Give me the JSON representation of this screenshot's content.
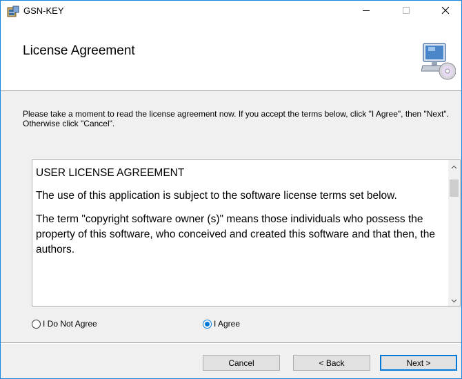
{
  "window": {
    "title": "GSN-KEY",
    "minimize_icon": "minimize-icon",
    "maximize_icon": "maximize-icon",
    "close_icon": "close-icon"
  },
  "header": {
    "title": "License Agreement",
    "icon": "computer-cd-icon"
  },
  "instructions": "Please take a moment to read the license agreement now. If you accept the terms below, click \"I Agree\", then \"Next\". Otherwise click \"Cancel\".",
  "license": {
    "heading": "USER LICENSE AGREEMENT",
    "paragraphs": [
      "The use of this application is subject to the software license terms set below.",
      "The term \"copyright software owner (s)\" means those individuals who possess the property of this software, who conceived and created this software and that then, the authors."
    ]
  },
  "options": {
    "disagree_label": "I Do Not Agree",
    "agree_label": "I Agree",
    "selected": "I Agree"
  },
  "buttons": {
    "cancel": "Cancel",
    "back": "< Back",
    "next": "Next >"
  },
  "colors": {
    "accent": "#0078d7",
    "window_border": "#1883d7"
  }
}
